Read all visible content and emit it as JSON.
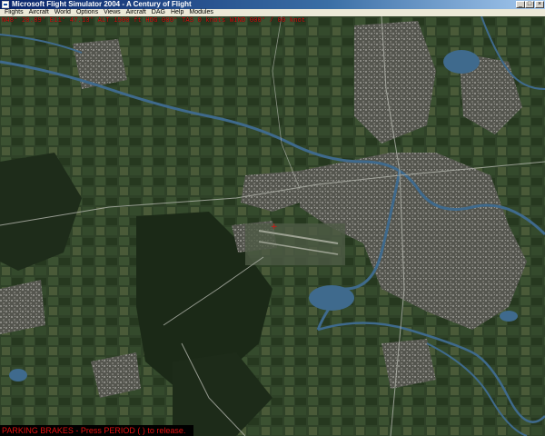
{
  "window": {
    "title": "Microsoft Flight Simulator 2004 - A Century of Flight",
    "app_icon": "fs-plane-icon",
    "controls": {
      "minimize": "_",
      "maximize": "□",
      "close": "×"
    }
  },
  "menu": {
    "items": [
      {
        "label": "Flights",
        "name": "menu-flights"
      },
      {
        "label": "Aircraft",
        "name": "menu-aircraft"
      },
      {
        "label": "World",
        "name": "menu-world"
      },
      {
        "label": "Options",
        "name": "menu-options"
      },
      {
        "label": "Views",
        "name": "menu-views"
      },
      {
        "label": "Aircraft",
        "name": "menu-aircraft-2"
      },
      {
        "label": "DAG",
        "name": "menu-dag"
      },
      {
        "label": "Help",
        "name": "menu-help"
      },
      {
        "label": "Modules",
        "name": "menu-modules"
      }
    ]
  },
  "hud": {
    "info_line": "N48° 20.89' E11° 47.13'  ALT 1500 ft  HDG 000°  TAS 0 knots  WIND 000° / 00 knot"
  },
  "status": {
    "message": "PARKING BRAKES - Press PERIOD ( ) to release."
  },
  "colors": {
    "hud_text": "#e01010",
    "terrain_base": "#2b3c24",
    "forest": "#1f2d1b",
    "urban": "#6b6a66",
    "water": "#3f6a8d",
    "road": "#b4b6ae"
  }
}
